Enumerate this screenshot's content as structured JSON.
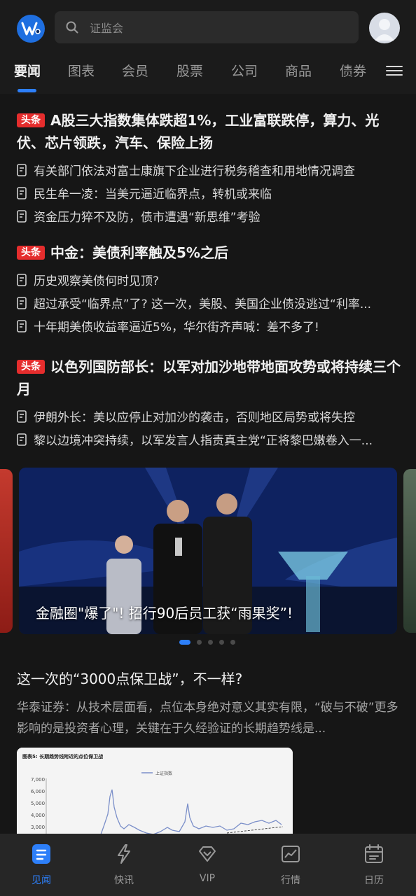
{
  "header": {
    "search_placeholder": "证监会"
  },
  "tabs": [
    "要闻",
    "图表",
    "会员",
    "股票",
    "公司",
    "商品",
    "债券"
  ],
  "news": [
    {
      "badge": "头条",
      "headline": "A股三大指数集体跌超1%，工业富联跌停，算力、光伏、芯片领跌，汽车、保险上扬",
      "subs": [
        "有关部门依法对富士康旗下企业进行税务稽查和用地情况调查",
        "民生牟一凌：当美元逼近临界点，转机或来临",
        "资金压力猝不及防，债市遭遇“新思维”考验"
      ]
    },
    {
      "badge": "头条",
      "headline": "中金：美债利率触及5%之后",
      "subs": [
        "历史观察美债何时见顶?",
        "超过承受“临界点”了? 这一次，美股、美国企业债没逃过“利率...",
        "十年期美债收益率逼近5%，华尔街齐声喊：差不多了!"
      ]
    },
    {
      "badge": "头条",
      "headline": "以色列国防部长：以军对加沙地带地面攻势或将持续三个月",
      "subs": [
        "伊朗外长：美以应停止对加沙的袭击，否则地区局势或将失控",
        "黎以边境冲突持续，以军发言人指责真主党“正将黎巴嫩卷入一..."
      ]
    }
  ],
  "carousel": {
    "caption": "金融圈\"爆了\"! 招行90后员工获“雨果奖”!",
    "dot_count": 5,
    "active_dot": 0
  },
  "article": {
    "title": "这一次的“3000点保卫战”，不一样?",
    "summary": "华泰证券：从技术层面看，点位本身绝对意义其实有限，“破与不破”更多影响的是投资者心理，关键在于久经验证的长期趋势线是...",
    "figure": {
      "caption": "图表5: 长期趋势线附近的点位保卫战",
      "legend": "上证指数",
      "yticks": [
        "7,000",
        "6,000",
        "5,000",
        "4,000",
        "3,000"
      ]
    }
  },
  "bottom_nav": [
    {
      "label": "见闻",
      "icon": "news-doc-icon",
      "active": true
    },
    {
      "label": "快讯",
      "icon": "lightning-icon",
      "active": false
    },
    {
      "label": "VIP",
      "icon": "diamond-icon",
      "active": false
    },
    {
      "label": "行情",
      "icon": "market-chart-icon",
      "active": false
    },
    {
      "label": "日历",
      "icon": "calendar-icon",
      "active": false
    }
  ],
  "colors": {
    "accent": "#2d7ff9",
    "badge": "#e52d2d",
    "background": "#161616"
  }
}
